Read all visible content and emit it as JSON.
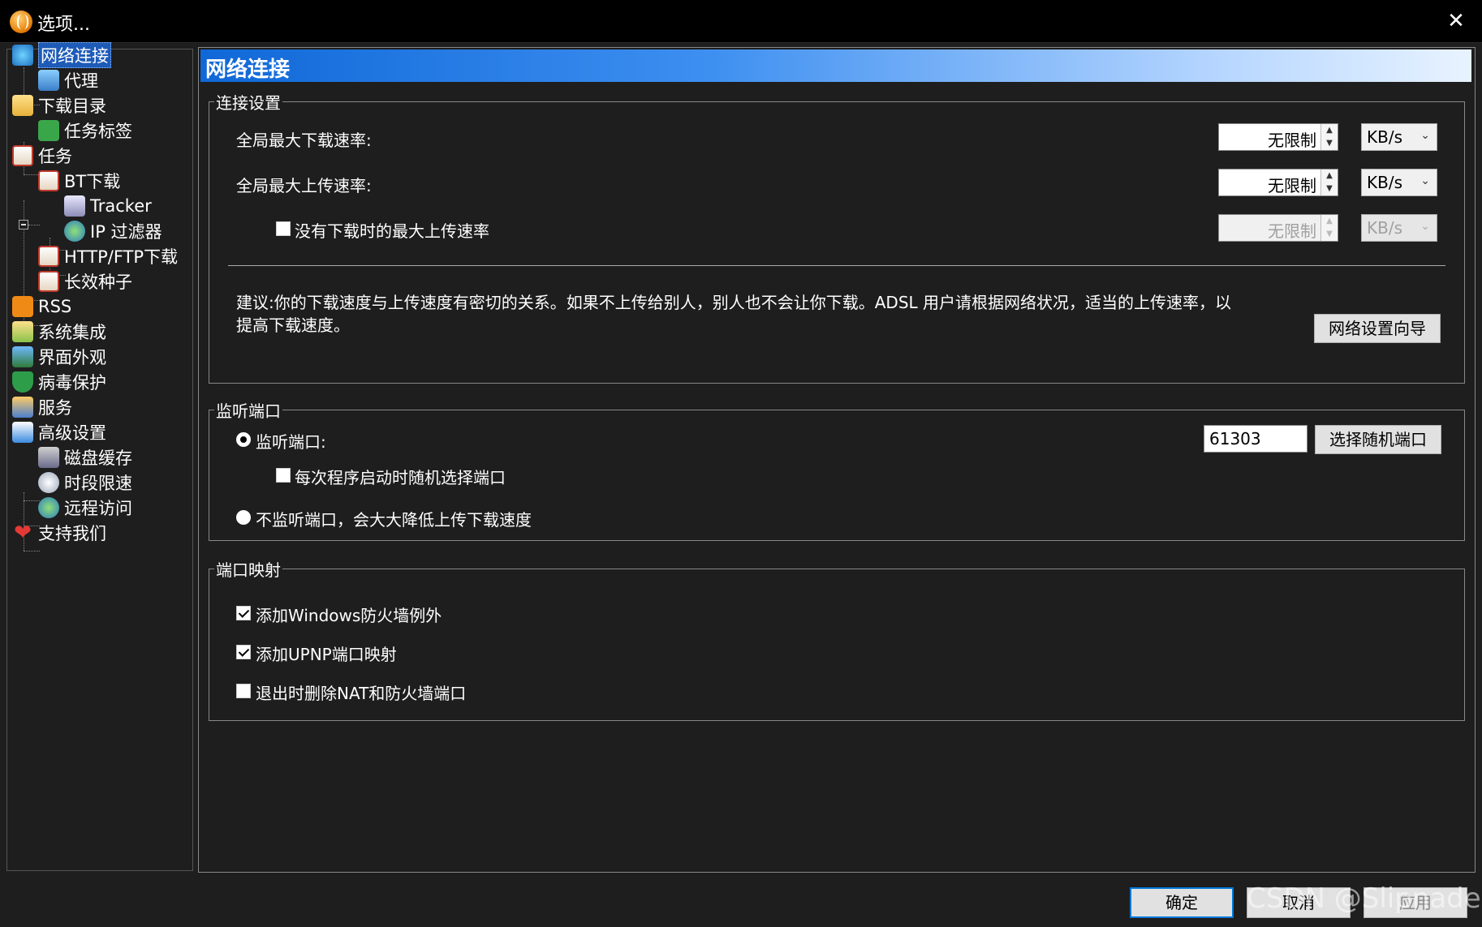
{
  "window": {
    "title": "选项..."
  },
  "sidebar": {
    "items": [
      {
        "label": "网络连接"
      },
      {
        "label": "代理"
      },
      {
        "label": "下载目录"
      },
      {
        "label": "任务标签"
      },
      {
        "label": "任务"
      },
      {
        "label": "BT下载"
      },
      {
        "label": "Tracker"
      },
      {
        "label": "IP 过滤器"
      },
      {
        "label": "HTTP/FTP下载"
      },
      {
        "label": "长效种子"
      },
      {
        "label": "RSS"
      },
      {
        "label": "系统集成"
      },
      {
        "label": "界面外观"
      },
      {
        "label": "病毒保护"
      },
      {
        "label": "服务"
      },
      {
        "label": "高级设置"
      },
      {
        "label": "磁盘缓存"
      },
      {
        "label": "时段限速"
      },
      {
        "label": "远程访问"
      },
      {
        "label": "支持我们"
      }
    ]
  },
  "main": {
    "header_title": "网络连接",
    "connection": {
      "legend": "连接设置",
      "max_download_label": "全局最大下载速率:",
      "max_download_value": "无限制",
      "max_download_unit": "KB/s",
      "max_upload_label": "全局最大上传速率:",
      "max_upload_value": "无限制",
      "max_upload_unit": "KB/s",
      "no_download_upload_label": "没有下载时的最大上传速率",
      "no_download_upload_checked": false,
      "no_download_upload_value": "无限制",
      "no_download_upload_unit": "KB/s",
      "advice_line1": "建议:你的下载速度与上传速度有密切的关系。如果不上传给别人，别人也不会让你下载。ADSL 用户请根据网络状况，适当的上传速率，以",
      "advice_line2": "提高下载速度。",
      "wizard_button": "网络设置向导"
    },
    "listen": {
      "legend": "监听端口",
      "listen_port_label": "监听端口:",
      "listen_port_selected": true,
      "port_value": "61303",
      "random_port_button": "选择随机端口",
      "random_each_start_label": "每次程序启动时随机选择端口",
      "random_each_start_checked": false,
      "no_listen_label": "不监听端口，会大大降低上传下载速度",
      "no_listen_selected": false
    },
    "mapping": {
      "legend": "端口映射",
      "firewall_label": "添加Windows防火墙例外",
      "firewall_checked": true,
      "upnp_label": "添加UPNP端口映射",
      "upnp_checked": true,
      "nat_remove_label": "退出时删除NAT和防火墙端口",
      "nat_remove_checked": false
    }
  },
  "footer": {
    "ok_button": "确定",
    "cancel_button": "取消",
    "apply_button": "应用",
    "watermark": "CSDN @Slipnades"
  }
}
